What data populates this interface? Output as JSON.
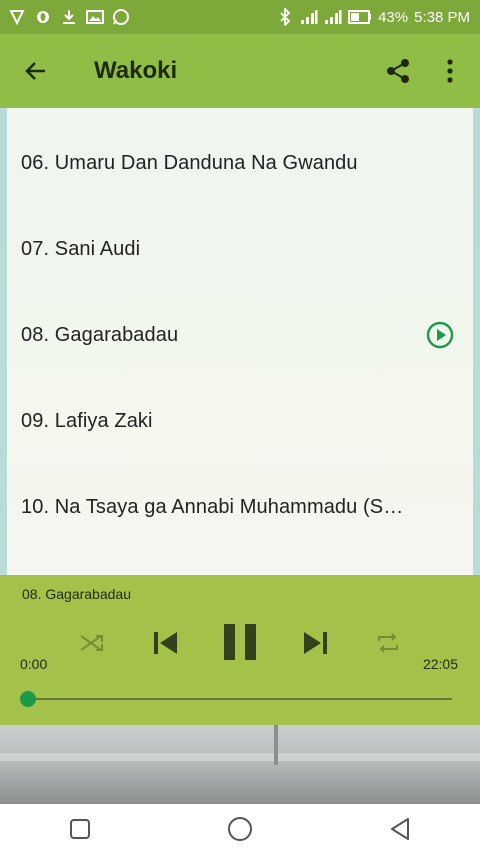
{
  "status_bar": {
    "battery": "43%",
    "time": "5:38 PM",
    "left_icons": [
      "vpn-icon",
      "opera-icon",
      "download-icon",
      "gallery-icon",
      "whatsapp-icon"
    ],
    "right_icons": [
      "bluetooth-icon",
      "signal-icon",
      "signal-icon",
      "battery-icon"
    ]
  },
  "app_bar": {
    "title": "Wakoki",
    "back_icon": "arrow-back-icon",
    "share_icon": "share-icon",
    "more_icon": "more-vert-icon"
  },
  "track_list": [
    {
      "label": "06. Umaru Dan Danduna Na Gwandu",
      "playing": false
    },
    {
      "label": "07. Sani Audi",
      "playing": false
    },
    {
      "label": "08. Gagarabadau",
      "playing": true
    },
    {
      "label": "09. Lafiya Zaki",
      "playing": false
    },
    {
      "label": "10. Na Tsaya ga Annabi Muhammadu (S…",
      "playing": false
    }
  ],
  "player": {
    "now_playing": "08. Gagarabadau",
    "elapsed": "0:00",
    "duration": "22:05",
    "progress": 0.0,
    "controls": [
      "shuffle-icon",
      "previous-icon",
      "pause-icon",
      "next-icon",
      "repeat-icon"
    ]
  },
  "colors": {
    "status_bar": "#7da83a",
    "app_bar": "#8fbd45",
    "player": "#a4c24a",
    "accent": "#1b9a4a"
  },
  "nav_bar": [
    "recents-icon",
    "home-icon",
    "back-icon"
  ]
}
